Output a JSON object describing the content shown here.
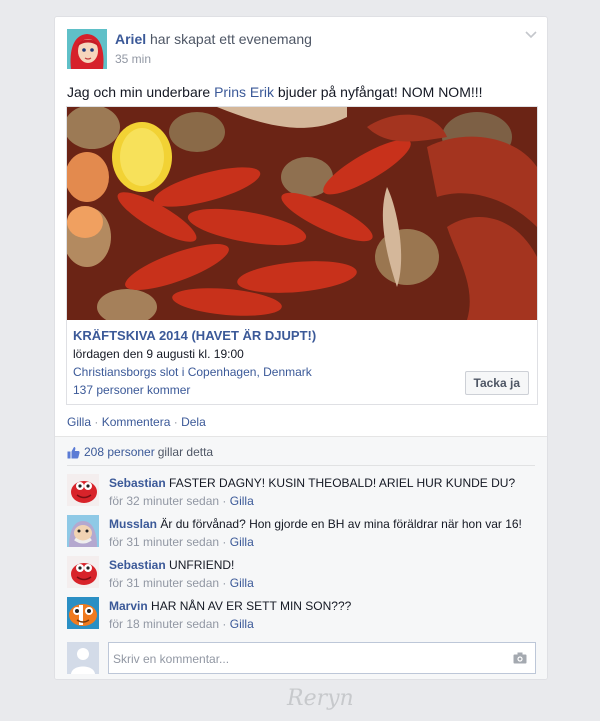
{
  "post": {
    "author": "Ariel",
    "action": "har skapat ett evenemang",
    "time": "35 min",
    "text_before": "Jag och min underbare ",
    "text_link": "Prins Erik",
    "text_after": " bjuder på nyfångat! NOM NOM!!!"
  },
  "event": {
    "title": "KRÄFTSKIVA 2014 (HAVET ÄR DJUPT!)",
    "date": "lördagen den 9 augusti kl. 19:00",
    "location": "Christiansborgs slot i Copenhagen, Denmark",
    "attending": "137 personer kommer",
    "join_label": "Tacka ja"
  },
  "actions": {
    "like": "Gilla",
    "comment": "Kommentera",
    "share": "Dela",
    "dot": "·"
  },
  "likes": {
    "count": "208 personer",
    "suffix": "gillar detta"
  },
  "comments": [
    {
      "author": "Sebastian",
      "text": "FASTER DAGNY! KUSIN THEOBALD! ARIEL HUR KUNDE DU?",
      "time": "för 32 minuter sedan",
      "like": "Gilla"
    },
    {
      "author": "Musslan",
      "text": "Är du förvånad? Hon gjorde en BH av mina föräldrar när hon var 16!",
      "time": "för 31 minuter sedan",
      "like": "Gilla"
    },
    {
      "author": "Sebastian",
      "text": "UNFRIEND!",
      "time": "för 31 minuter sedan",
      "like": "Gilla"
    },
    {
      "author": "Marvin",
      "text": "HAR NÅN AV ER SETT MIN SON???",
      "time": "för 18 minuter sedan",
      "like": "Gilla"
    }
  ],
  "composer": {
    "placeholder": "Skriv en kommentar..."
  },
  "signature": "Reryn",
  "colors": {
    "link": "#3b5998",
    "meta": "#9197a3",
    "background": "#e9eaed",
    "ufi": "#f6f7f8"
  },
  "icons": [
    "chevron-down-icon",
    "thumbs-up-icon",
    "camera-icon"
  ]
}
